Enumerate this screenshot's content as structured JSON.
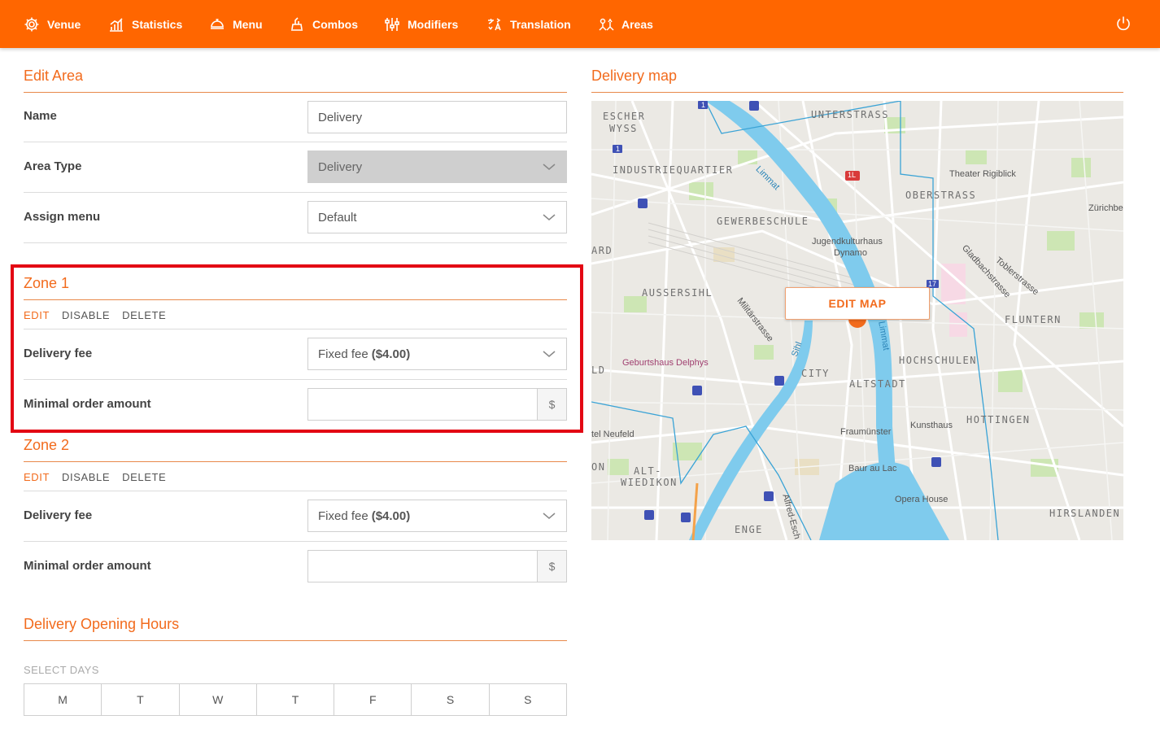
{
  "nav": {
    "items": [
      {
        "label": "Venue",
        "icon": "gear-icon"
      },
      {
        "label": "Statistics",
        "icon": "statistics-icon"
      },
      {
        "label": "Menu",
        "icon": "cloche-icon"
      },
      {
        "label": "Combos",
        "icon": "combo-icon"
      },
      {
        "label": "Modifiers",
        "icon": "sliders-icon"
      },
      {
        "label": "Translation",
        "icon": "translation-icon"
      },
      {
        "label": "Areas",
        "icon": "areas-icon"
      }
    ],
    "power_icon": "power-icon",
    "accent_color": "#ff6600"
  },
  "edit_area": {
    "title": "Edit Area",
    "name_label": "Name",
    "name_value": "Delivery",
    "area_type_label": "Area Type",
    "area_type_value": "Delivery",
    "assign_menu_label": "Assign menu",
    "assign_menu_value": "Default"
  },
  "zones": [
    {
      "title": "Zone 1",
      "actions": {
        "edit": "EDIT",
        "disable": "DISABLE",
        "delete": "DELETE"
      },
      "delivery_fee_label": "Delivery fee",
      "delivery_fee_prefix": "Fixed fee",
      "delivery_fee_amount": "($4.00)",
      "min_order_label": "Minimal order amount",
      "min_order_value": "",
      "currency": "$"
    },
    {
      "title": "Zone 2",
      "actions": {
        "edit": "EDIT",
        "disable": "DISABLE",
        "delete": "DELETE"
      },
      "delivery_fee_label": "Delivery fee",
      "delivery_fee_prefix": "Fixed fee",
      "delivery_fee_amount": "($4.00)",
      "min_order_label": "Minimal order amount",
      "min_order_value": "",
      "currency": "$"
    }
  ],
  "opening_hours": {
    "title": "Delivery Opening Hours",
    "select_days_label": "SELECT DAYS",
    "days": [
      "M",
      "T",
      "W",
      "T",
      "F",
      "S",
      "S"
    ]
  },
  "delivery_map": {
    "title": "Delivery map",
    "edit_button": "EDIT MAP",
    "labels": {
      "escher_wyss_1": "ESCHER",
      "escher_wyss_2": "WYSS",
      "unterstrass": "UNTERSTRASS",
      "industriequartier": "INDUSTRIEQUARTIER",
      "oberstrass": "OBERSTRASS",
      "gewerbeschule": "GEWERBESCHULE",
      "ard": "ARD",
      "aussersihl": "AUSSERSIHL",
      "fluntern": "FLUNTERN",
      "hochschulen": "HOCHSCHULEN",
      "city": "CITY",
      "altstadt": "ALTSTADT",
      "hottingen": "HOTTINGEN",
      "on": "ON",
      "alt_wiedikon_1": "ALT-",
      "alt_wiedikon_2": "WIEDIKON",
      "enge": "ENGE",
      "hirslanden": "HIRSLANDEN",
      "ld": "LD",
      "theater_rigiblick": "Theater Rigiblick",
      "zurichbe": "Zürichbe",
      "jugendkulturhaus_1": "Jugendkulturhaus",
      "jugendkulturhaus_2": "Dynamo",
      "militarstrasse": "Militärstrasse",
      "gladbachstrasse": "Gladbachstrasse",
      "toblerstrasse": "Toblerstrasse",
      "limmat": "Limmat",
      "limmat2": "Limmat",
      "sihl": "Sihl",
      "geburtshaus": "Geburtshaus Delphys",
      "fraumunster": "Fraumünster",
      "kunsthaus": "Kunsthaus",
      "tel_neufeld": "tel Neufeld",
      "baur_au_lac": "Baur au Lac",
      "opera_house": "Opera House",
      "alfred_esch": "Alfred-Esch",
      "route_1a": "1",
      "route_1b": "1",
      "route_1l": "1L",
      "route_17": "17"
    }
  }
}
